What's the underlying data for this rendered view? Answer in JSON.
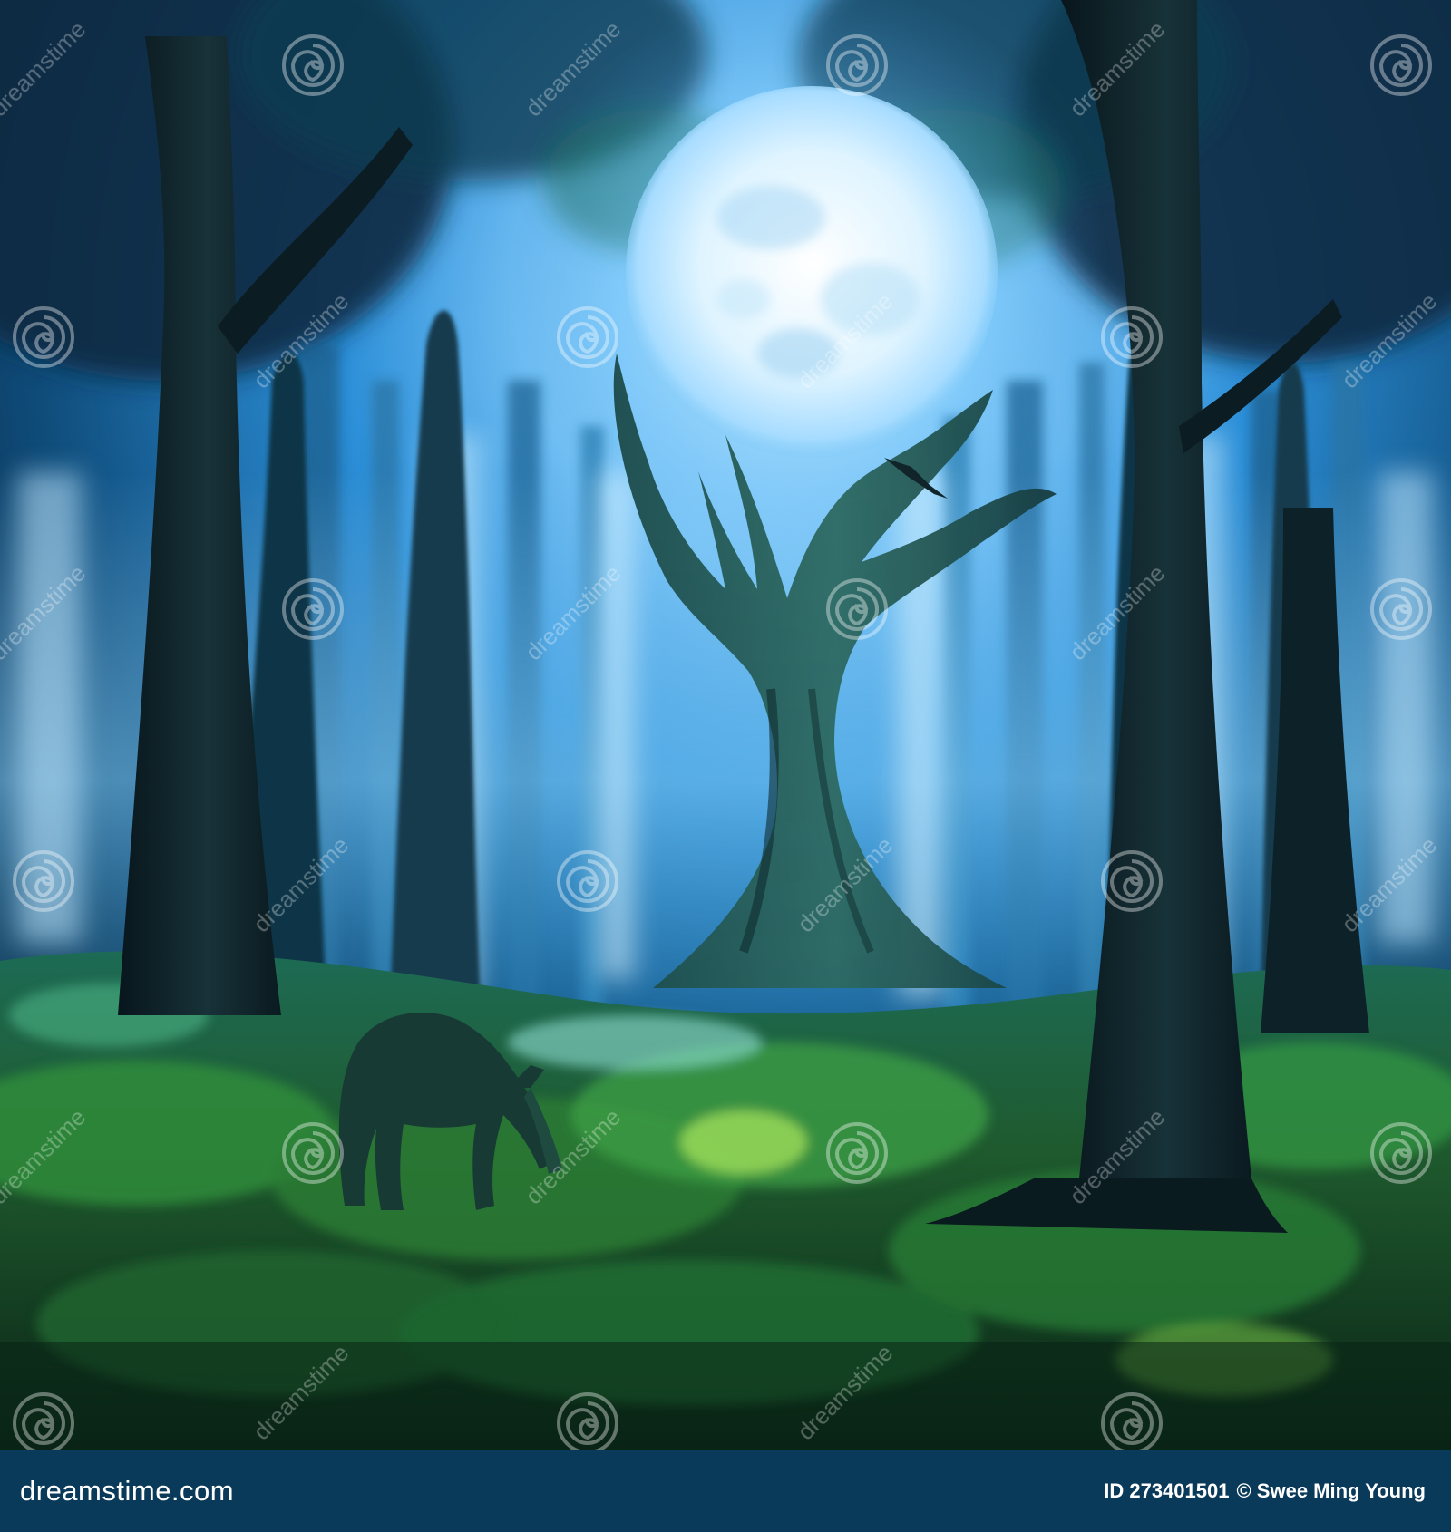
{
  "image": {
    "palette": {
      "sky_glow": "#bfe7ff",
      "moon": "#e8f7ff",
      "mist_blue": "#3aa3e8",
      "deep_blue": "#0a2a44",
      "trunk_dark": "#0d1c22",
      "moss_green": "#2f8f3c",
      "moss_bright": "#7fd14a",
      "footer_bg": "#0a3a5a"
    }
  },
  "watermark": {
    "text": "dreamstime",
    "icon": "spiral-logo-icon"
  },
  "footer": {
    "brand": "dreamstime.com",
    "id_label": "ID 273401501",
    "credit": "© Swee Ming Young"
  }
}
